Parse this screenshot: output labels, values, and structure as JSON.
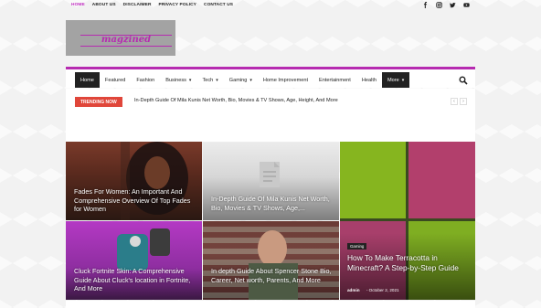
{
  "top_menu": [
    "HOME",
    "ABOUT US",
    "DISCLAIMER",
    "PRIVACY POLICY",
    "CONTACT US"
  ],
  "social_icons": [
    "facebook-icon",
    "instagram-icon",
    "twitter-icon",
    "youtube-icon"
  ],
  "logo": {
    "text": "magzined"
  },
  "nav": {
    "items": [
      {
        "label": "Home",
        "dropdown": false
      },
      {
        "label": "Featured",
        "dropdown": false
      },
      {
        "label": "Fashion",
        "dropdown": false
      },
      {
        "label": "Business",
        "dropdown": true
      },
      {
        "label": "Tech",
        "dropdown": true
      },
      {
        "label": "Gaming",
        "dropdown": true
      },
      {
        "label": "Home Improvement",
        "dropdown": false
      },
      {
        "label": "Entertainment",
        "dropdown": false
      },
      {
        "label": "Health",
        "dropdown": false
      },
      {
        "label": "More",
        "dropdown": true
      }
    ],
    "search_icon": "search-icon"
  },
  "trending": {
    "badge": "TRENDING NOW",
    "headline": "In-Depth Guide Of Mila Kunis Net Worth, Bio, Movies & TV Shows, Age, Height, And More"
  },
  "cards": [
    {
      "title": "Fades For Women: An Important And Comprehensive Overview Of Top Fades for Women"
    },
    {
      "title": "In-Depth Guide Of Mila Kunis Net Worth, Bio, Movies & TV Shows, Age,..."
    },
    {
      "title": "Cluck Fortnite Skin: A Comprehensive Guide About Cluck's location in Fortnite, And More"
    },
    {
      "title": "In depth Guide About Spencer Stone Bio, Career, Net worth, Parents, And More"
    }
  ],
  "feature": {
    "tag": "Gaming",
    "title": "How To Make Terracotta in Minecraft? A Step-by-Step Guide",
    "author": "admin",
    "date": "October 2, 2021"
  },
  "colors": {
    "accent": "#b62bb0",
    "trending_badge": "#e0463a",
    "nav_active": "#222222"
  }
}
